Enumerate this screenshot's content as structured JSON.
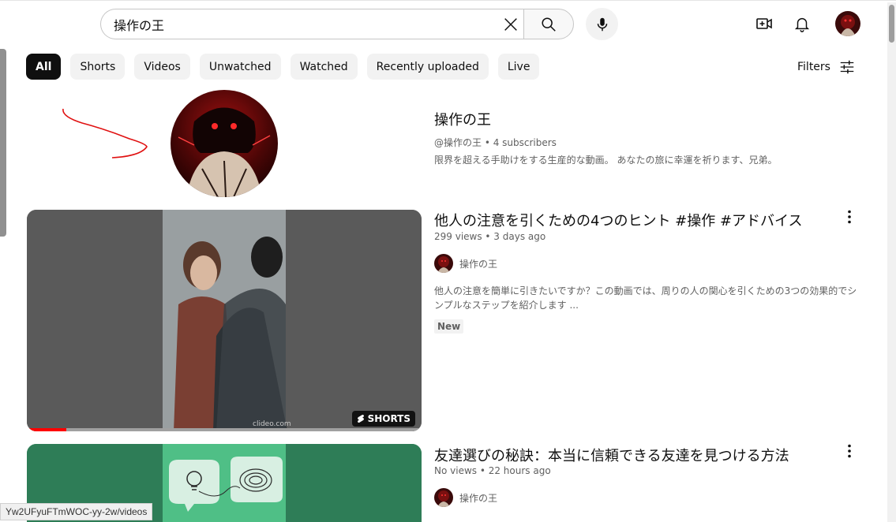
{
  "search": {
    "query": "操作の王"
  },
  "chips": [
    {
      "label": "All",
      "active": true
    },
    {
      "label": "Shorts"
    },
    {
      "label": "Videos"
    },
    {
      "label": "Unwatched"
    },
    {
      "label": "Watched"
    },
    {
      "label": "Recently uploaded"
    },
    {
      "label": "Live"
    }
  ],
  "filters_label": "Filters",
  "channel": {
    "name": "操作の王",
    "meta": "@操作の王 • 4 subscribers",
    "description": "限界を超える手助けをする生産的な動画。 あなたの旅に幸運を祈ります、兄弟。"
  },
  "videos": [
    {
      "title": "他人の注意を引くための4つのヒント #操作 #アドバイス",
      "meta": "299 views • 3 days ago",
      "channel": "操作の王",
      "description": "他人の注意を簡単に引きたいですか？この動画では、周りの人の関心を引くための3つの効果的でシンプルなステップを紹介します ...",
      "badge": "New",
      "shorts_label": "SHORTS",
      "watermark": "clideo.com",
      "progress": 0.1
    },
    {
      "title": "友達選びの秘訣：本当に信頼できる友達を見つける方法",
      "meta": "No views • 22 hours ago",
      "channel": "操作の王"
    }
  ],
  "status_url": "Yw2UFyuFTmWOC-yy-2w/videos",
  "colors": {
    "accent": "#ff0000",
    "chip_active": "#0f0f0f",
    "thumb2_bg": "#2e7d57"
  }
}
